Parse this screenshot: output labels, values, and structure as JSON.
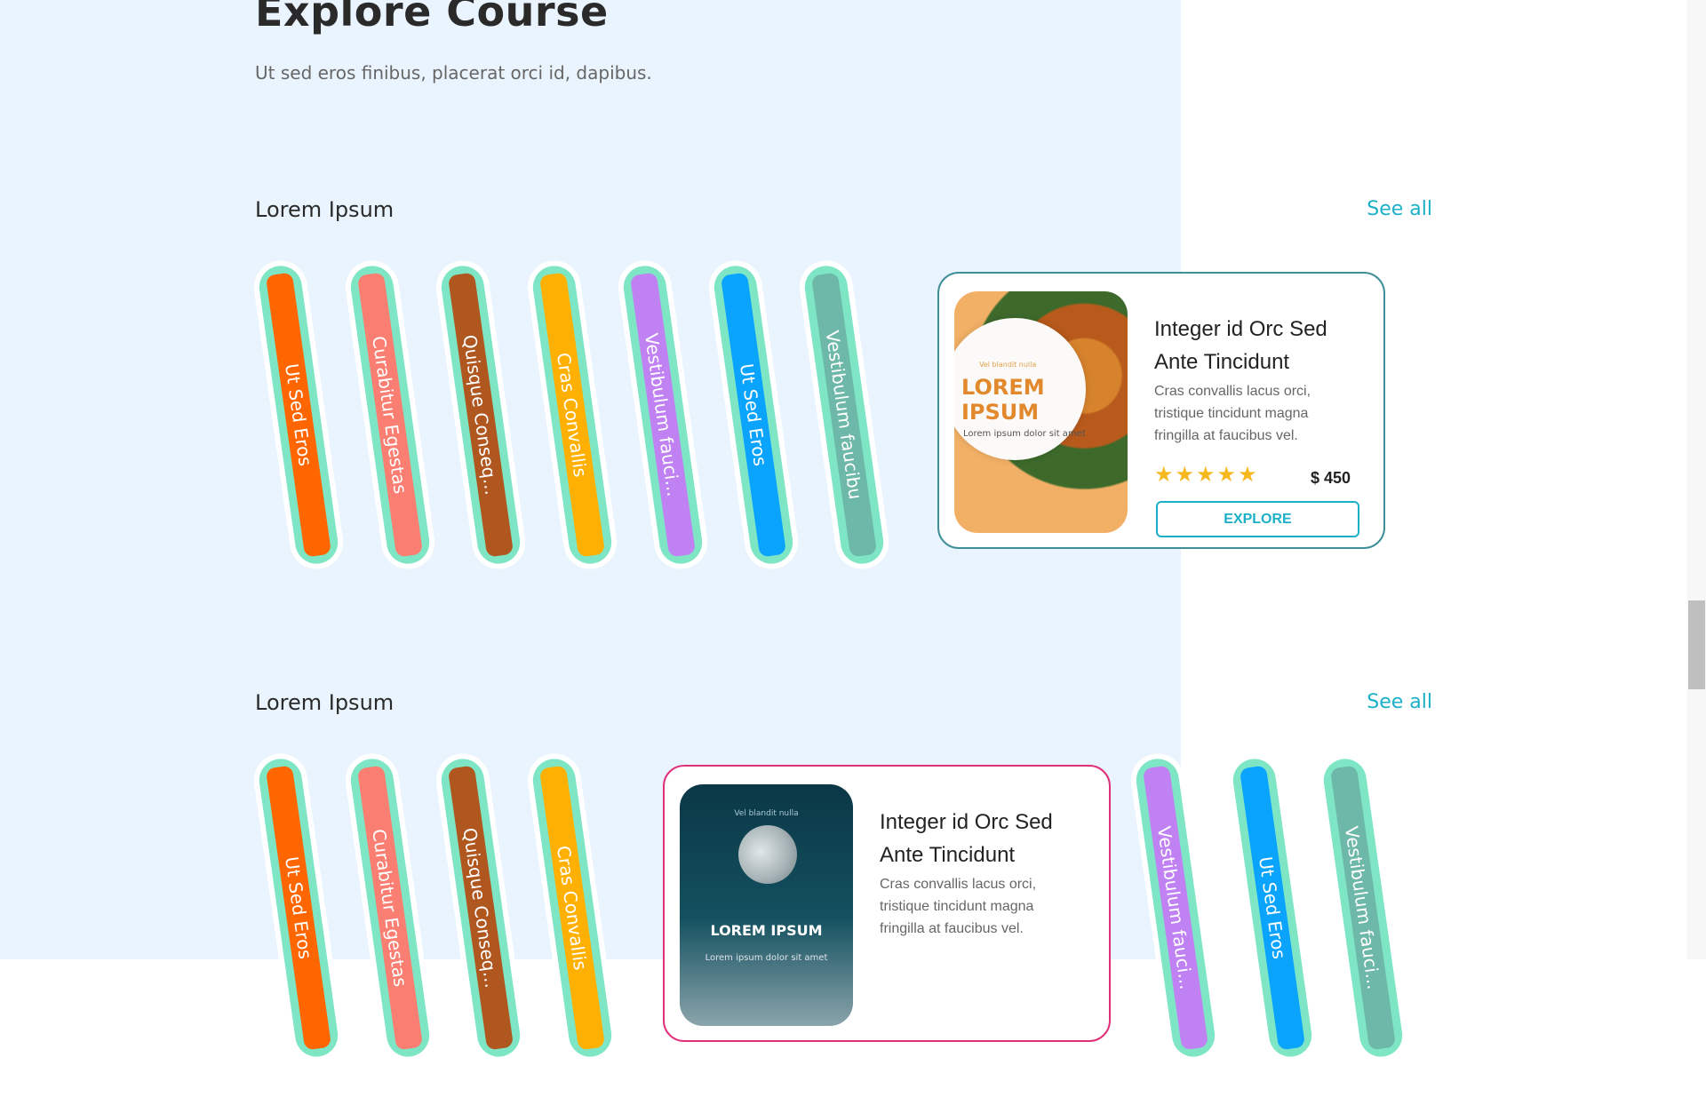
{
  "page": {
    "title": "Explore Course",
    "subtitle": "Ut sed eros finibus, placerat orci id, dapibus."
  },
  "sections": [
    {
      "title": "Lorem Ipsum",
      "see_all": "See all",
      "tabs": [
        {
          "label": "Ut Sed Eros",
          "color": "#ff6600"
        },
        {
          "label": "Curabitur Egestas",
          "color": "#fa7f72"
        },
        {
          "label": "Quisque Conseq...",
          "color": "#b0561f"
        },
        {
          "label": "Cras Convallis",
          "color": "#ffb000"
        },
        {
          "label": "Vestibulum fauci...",
          "color": "#c082f3"
        },
        {
          "label": "Ut Sed Eros",
          "color": "#0aa4ff"
        },
        {
          "label": "Vestibulum faucibu",
          "color": "#6db8a8"
        }
      ],
      "card": {
        "image_small": "Vel blandit nulla",
        "image_title": "LOREM IPSUM",
        "image_caption": "Lorem ipsum dolor sit amet",
        "title": "Integer id Orc Sed Ante Tincidunt",
        "description": "Cras convallis lacus orci, tristique tincidunt magna fringilla at faucibus vel.",
        "stars": "★★★★★",
        "rating": 5,
        "price": "$ 450",
        "button": "EXPLORE",
        "border_color": "#3f8f98"
      }
    },
    {
      "title": "Lorem Ipsum",
      "see_all": "See all",
      "tabs": [
        {
          "label": "Ut Sed Eros",
          "color": "#ff6600"
        },
        {
          "label": "Curabitur Egestas",
          "color": "#fa7f72"
        },
        {
          "label": "Quisque Conseq...",
          "color": "#b0561f"
        },
        {
          "label": "Cras Convallis",
          "color": "#ffb000"
        },
        {
          "label": "Vestibulum fauci...",
          "color": "#c082f3"
        },
        {
          "label": "Ut Sed Eros",
          "color": "#0aa4ff"
        },
        {
          "label": "Vestibulum fauci...",
          "color": "#6db8a8"
        }
      ],
      "card": {
        "image_small": "Vel blandit nulla",
        "image_title": "LOREM IPSUM",
        "image_caption": "Lorem ipsum dolor sit amet",
        "title": "Integer id Orc Sed Ante Tincidunt",
        "description": "Cras convallis lacus orci, tristique tincidunt magna fringilla at faucibus vel.",
        "border_color": "#e0307a"
      }
    }
  ],
  "colors": {
    "accent": "#1bb0c8",
    "star": "#f5b91f",
    "background": "#eaf4fe",
    "tab_outline": "#7ee6c5"
  }
}
